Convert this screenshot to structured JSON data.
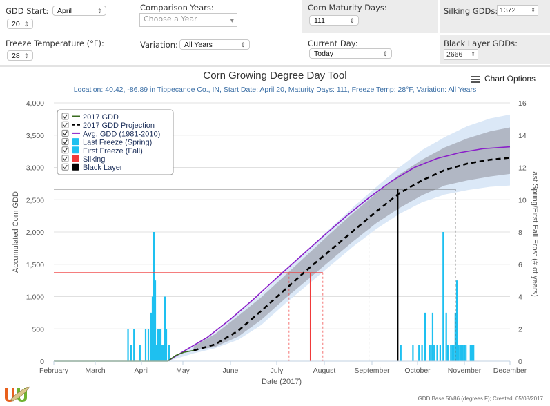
{
  "controls": {
    "gdd_start_label": "GDD Start:",
    "gdd_start_month": "April",
    "gdd_start_day": "20",
    "comparison_years_label": "Comparison Years:",
    "comparison_years_placeholder": "Choose a Year",
    "freeze_temp_label": "Freeze Temperature (°F):",
    "freeze_temp_value": "28",
    "variation_label": "Variation:",
    "variation_value": "All Years",
    "maturity_days_label": "Corn Maturity Days:",
    "maturity_days_value": "111",
    "current_day_label": "Current Day:",
    "current_day_value": "Today",
    "silking_gdds_label": "Silking GDDs:",
    "silking_gdds_value": "1372",
    "black_layer_gdds_label": "Black Layer GDDs:",
    "black_layer_gdds_value": "2666"
  },
  "chart_options_label": "Chart Options",
  "footer": "GDD Base 50/86 (degrees F); Created: 05/08/2017",
  "chart_data": {
    "type": "line",
    "title": "Corn Growing Degree Day Tool",
    "subtitle": "Location: 40.42, -86.89 in Tippecanoe Co., IN, Start Date: April 20, Maturity Days: 111, Freeze Temp: 28°F, Variation: All Years",
    "xlabel": "Date (2017)",
    "ylabel": "Accumulated Corn GDD",
    "y2label": "Last Spring/First Fall Frost (# of years)",
    "x_ticks": [
      "February",
      "March",
      "April",
      "May",
      "June",
      "July",
      "August",
      "September",
      "October",
      "November",
      "December"
    ],
    "x_range_days": [
      0,
      303
    ],
    "ylim": [
      0,
      4000
    ],
    "y_ticks": [
      "0",
      "500",
      "1,000",
      "1,500",
      "2,000",
      "2,500",
      "3,000",
      "3,500",
      "4,000"
    ],
    "y2lim": [
      0,
      16
    ],
    "y2_ticks": [
      "0",
      "2",
      "4",
      "6",
      "8",
      "10",
      "12",
      "14",
      "16"
    ],
    "legend_position": "top-left",
    "legend": [
      {
        "label": "2017 GDD",
        "color": "#3a6b1f",
        "kind": "line"
      },
      {
        "label": "2017 GDD Projection",
        "color": "#000000",
        "kind": "dash"
      },
      {
        "label": "Avg. GDD (1981-2010)",
        "color": "#8a1fc9",
        "kind": "line"
      },
      {
        "label": "Last Freeze (Spring)",
        "color": "#1ec0f0",
        "kind": "box"
      },
      {
        "label": "First Freeze (Fall)",
        "color": "#1ec0f0",
        "kind": "box"
      },
      {
        "label": "Silking",
        "color": "#f03a3a",
        "kind": "box"
      },
      {
        "label": "Black Layer",
        "color": "#000000",
        "kind": "box"
      }
    ],
    "series": [
      {
        "name": "2017 GDD",
        "x_days": [
          0,
          78,
          84,
          90,
          96
        ],
        "y": [
          0,
          0,
          90,
          140,
          165
        ]
      },
      {
        "name": "2017 GDD Projection",
        "x_days": [
          96,
          110,
          125,
          140,
          155,
          170,
          185,
          200,
          215,
          230,
          245,
          260,
          275,
          290,
          303
        ],
        "y": [
          165,
          260,
          470,
          780,
          1100,
          1420,
          1720,
          2020,
          2320,
          2600,
          2800,
          2960,
          3060,
          3120,
          3150
        ]
      },
      {
        "name": "Avg. GDD (1981-2010)",
        "x_days": [
          78,
          90,
          105,
          120,
          135,
          150,
          165,
          180,
          195,
          210,
          225,
          240,
          255,
          270,
          285,
          303
        ],
        "y": [
          0,
          160,
          370,
          650,
          960,
          1290,
          1610,
          1930,
          2240,
          2530,
          2790,
          3000,
          3140,
          3230,
          3290,
          3320
        ]
      }
    ],
    "bands": [
      {
        "name": "outer range",
        "color": "#dbe8f7",
        "x_days": [
          78,
          96,
          110,
          125,
          140,
          155,
          170,
          185,
          200,
          215,
          230,
          245,
          260,
          275,
          290,
          303
        ],
        "upper": [
          0,
          230,
          440,
          740,
          1040,
          1390,
          1720,
          2060,
          2390,
          2700,
          3000,
          3270,
          3470,
          3640,
          3760,
          3820
        ],
        "lower": [
          0,
          120,
          200,
          330,
          560,
          880,
          1180,
          1480,
          1780,
          2050,
          2280,
          2460,
          2580,
          2650,
          2700,
          2720
        ]
      },
      {
        "name": "inner range",
        "color": "#a9aebb",
        "x_days": [
          96,
          110,
          125,
          140,
          155,
          170,
          185,
          200,
          215,
          230,
          245,
          260,
          275,
          290,
          303
        ],
        "upper": [
          230,
          420,
          700,
          990,
          1320,
          1650,
          1980,
          2300,
          2600,
          2890,
          3120,
          3310,
          3450,
          3560,
          3620
        ],
        "lower": [
          165,
          220,
          380,
          640,
          960,
          1260,
          1560,
          1860,
          2140,
          2370,
          2570,
          2720,
          2800,
          2860,
          2900
        ]
      }
    ],
    "markers": {
      "silking": {
        "gdd": 1372,
        "day": 172,
        "range_days": [
          158,
          180
        ],
        "color": "#f03a3a"
      },
      "black_layer": {
        "gdd": 2666,
        "day": 229,
        "range_days": [
          210,
          267
        ],
        "color": "#000000"
      }
    },
    "last_freeze_spring": {
      "x_days": [
        50,
        52,
        54,
        56,
        58,
        60,
        62,
        64,
        66,
        67,
        68,
        69,
        70,
        71,
        72,
        73,
        74,
        75,
        76,
        77,
        78,
        79
      ],
      "counts": [
        2,
        1,
        2,
        0,
        1,
        0,
        2,
        2,
        3,
        4,
        8,
        5,
        1,
        2,
        2,
        2,
        1,
        1,
        4,
        2,
        0,
        1
      ]
    },
    "first_freeze_fall": {
      "x_days": [
        231,
        239,
        243,
        245,
        247,
        250,
        251,
        252,
        253,
        255,
        257,
        259,
        261,
        262,
        264,
        265,
        266,
        267,
        268,
        269,
        270,
        271,
        272,
        273,
        274,
        277,
        278,
        279
      ],
      "counts": [
        1,
        1,
        1,
        1,
        3,
        1,
        1,
        3,
        1,
        1,
        1,
        8,
        3,
        1,
        1,
        1,
        1,
        3,
        5,
        1,
        1,
        1,
        1,
        1,
        1,
        1,
        1,
        1
      ]
    }
  }
}
